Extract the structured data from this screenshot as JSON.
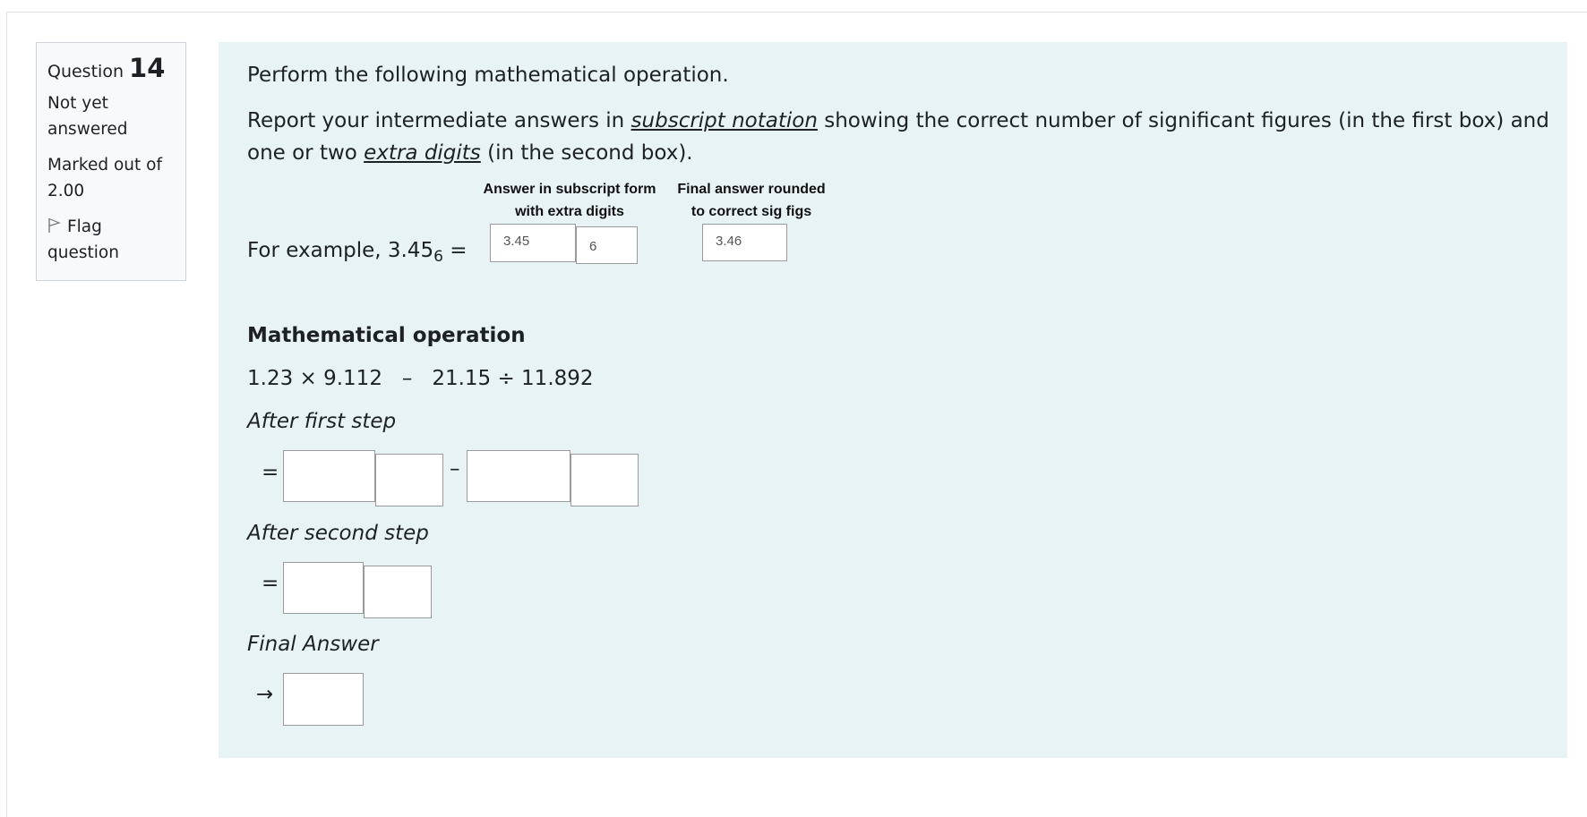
{
  "info": {
    "question_label": "Question",
    "question_number": "14",
    "state": "Not yet answered",
    "grade": "Marked out of 2.00",
    "flag_label": "Flag question",
    "flag_icon": "flag-icon"
  },
  "content": {
    "instruction_1": "Perform the following mathematical operation.",
    "instruction_2_parts": {
      "a": "Report your intermediate answers in ",
      "b": "subscript notation",
      "c": " showing the correct number of significant figures (in the first box) and one or two ",
      "d": "extra digits",
      "e": " (in the second box)."
    },
    "example": {
      "label_prefix": "For example, 3.45",
      "label_subscript": "6",
      "label_suffix": " =",
      "heading_subscript_line1": "Answer in subscript form",
      "heading_subscript_line2": "with extra digits",
      "heading_final_line1": "Final answer rounded",
      "heading_final_line2": "to correct sig figs",
      "box_main": "3.45",
      "box_extra": "6",
      "box_final": "3.46"
    },
    "operation_heading": "Mathematical operation",
    "operation": "1.23 × 9.112   –   21.15 ÷ 11.892",
    "step1_label": "After first step",
    "step2_label": "After second step",
    "final_label": "Final Answer",
    "equals_symbol": "=",
    "minus_symbol": "–",
    "arrow_symbol": "→",
    "inputs": {
      "step1_term1_main": "",
      "step1_term1_extra": "",
      "step1_term2_main": "",
      "step1_term2_extra": "",
      "step2_main": "",
      "step2_extra": "",
      "final": ""
    }
  }
}
